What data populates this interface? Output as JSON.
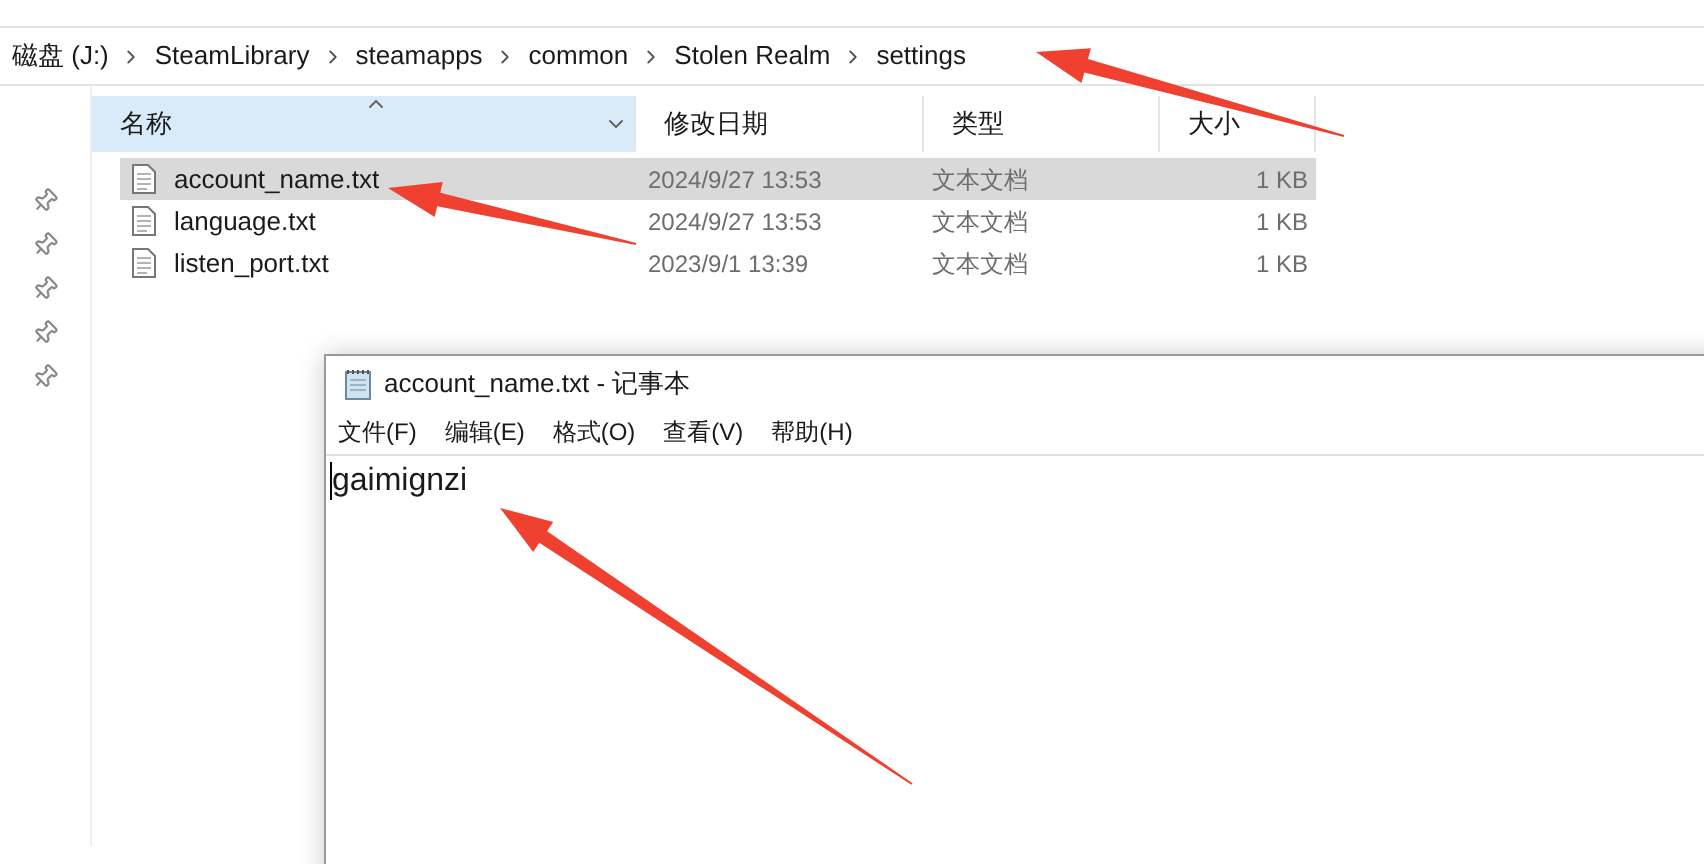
{
  "address_bar": {
    "breadcrumbs": [
      "磁盘 (J:)",
      "SteamLibrary",
      "steamapps",
      "common",
      "Stolen Realm",
      "settings"
    ]
  },
  "columns": [
    {
      "label": "名称",
      "sorted": true
    },
    {
      "label": "修改日期",
      "sorted": false
    },
    {
      "label": "类型",
      "sorted": false
    },
    {
      "label": "大小",
      "sorted": false
    }
  ],
  "files": [
    {
      "name": "account_name.txt",
      "modified": "2024/9/27 13:53",
      "type": "文本文档",
      "size": "1 KB",
      "selected": true
    },
    {
      "name": "language.txt",
      "modified": "2024/9/27 13:53",
      "type": "文本文档",
      "size": "1 KB",
      "selected": false
    },
    {
      "name": "listen_port.txt",
      "modified": "2023/9/1 13:39",
      "type": "文本文档",
      "size": "1 KB",
      "selected": false
    }
  ],
  "notepad": {
    "title": "account_name.txt - 记事本",
    "menu": [
      "文件(F)",
      "编辑(E)",
      "格式(O)",
      "查看(V)",
      "帮助(H)"
    ],
    "content": "gaimignzi"
  }
}
